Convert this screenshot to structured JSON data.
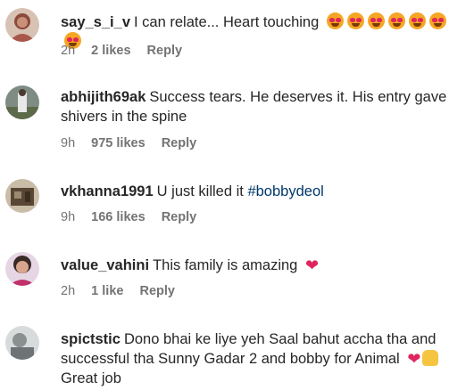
{
  "comments": [
    {
      "username": "say_s_i_v",
      "text": "I can relate... Heart touching",
      "time": "2h",
      "likes": "2 likes",
      "reply": "Reply",
      "emojis": [
        "smiling-face-with-heart-eyes-icon",
        "smiling-face-with-heart-eyes-icon",
        "smiling-face-with-heart-eyes-icon",
        "smiling-face-with-heart-eyes-icon",
        "smiling-face-with-heart-eyes-icon",
        "smiling-face-with-heart-eyes-icon",
        "smiling-face-with-heart-eyes-icon"
      ],
      "avatar_color": "#8b4a3a"
    },
    {
      "username": "abhijith69ak",
      "text": "Success tears. He deserves it. His entry gave shivers in the spine",
      "time": "9h",
      "likes": "975 likes",
      "reply": "Reply",
      "avatar_color": "#4a5a5e"
    },
    {
      "username": "vkhanna1991",
      "text": "U just killed it",
      "hashtag": "#bobbydeol",
      "time": "9h",
      "likes": "166 likes",
      "reply": "Reply",
      "avatar_color": "#6b5a45"
    },
    {
      "username": "value_vahini",
      "text": "This family is amazing",
      "time": "2h",
      "likes": "1 like",
      "reply": "Reply",
      "emojis": [
        "red-heart-icon"
      ],
      "avatar_color": "#c79a8a"
    },
    {
      "username": "spictstic",
      "text_line1": "Dono bhai ke liye yeh Saal bahut accha tha and",
      "text_line2": "successful tha Sunny Gadar 2 and bobby for Animal",
      "text_line3": "Great job",
      "emojis": [
        "red-heart-icon",
        "raising-hands-icon"
      ],
      "avatar_color": "#b0b6b8"
    }
  ]
}
